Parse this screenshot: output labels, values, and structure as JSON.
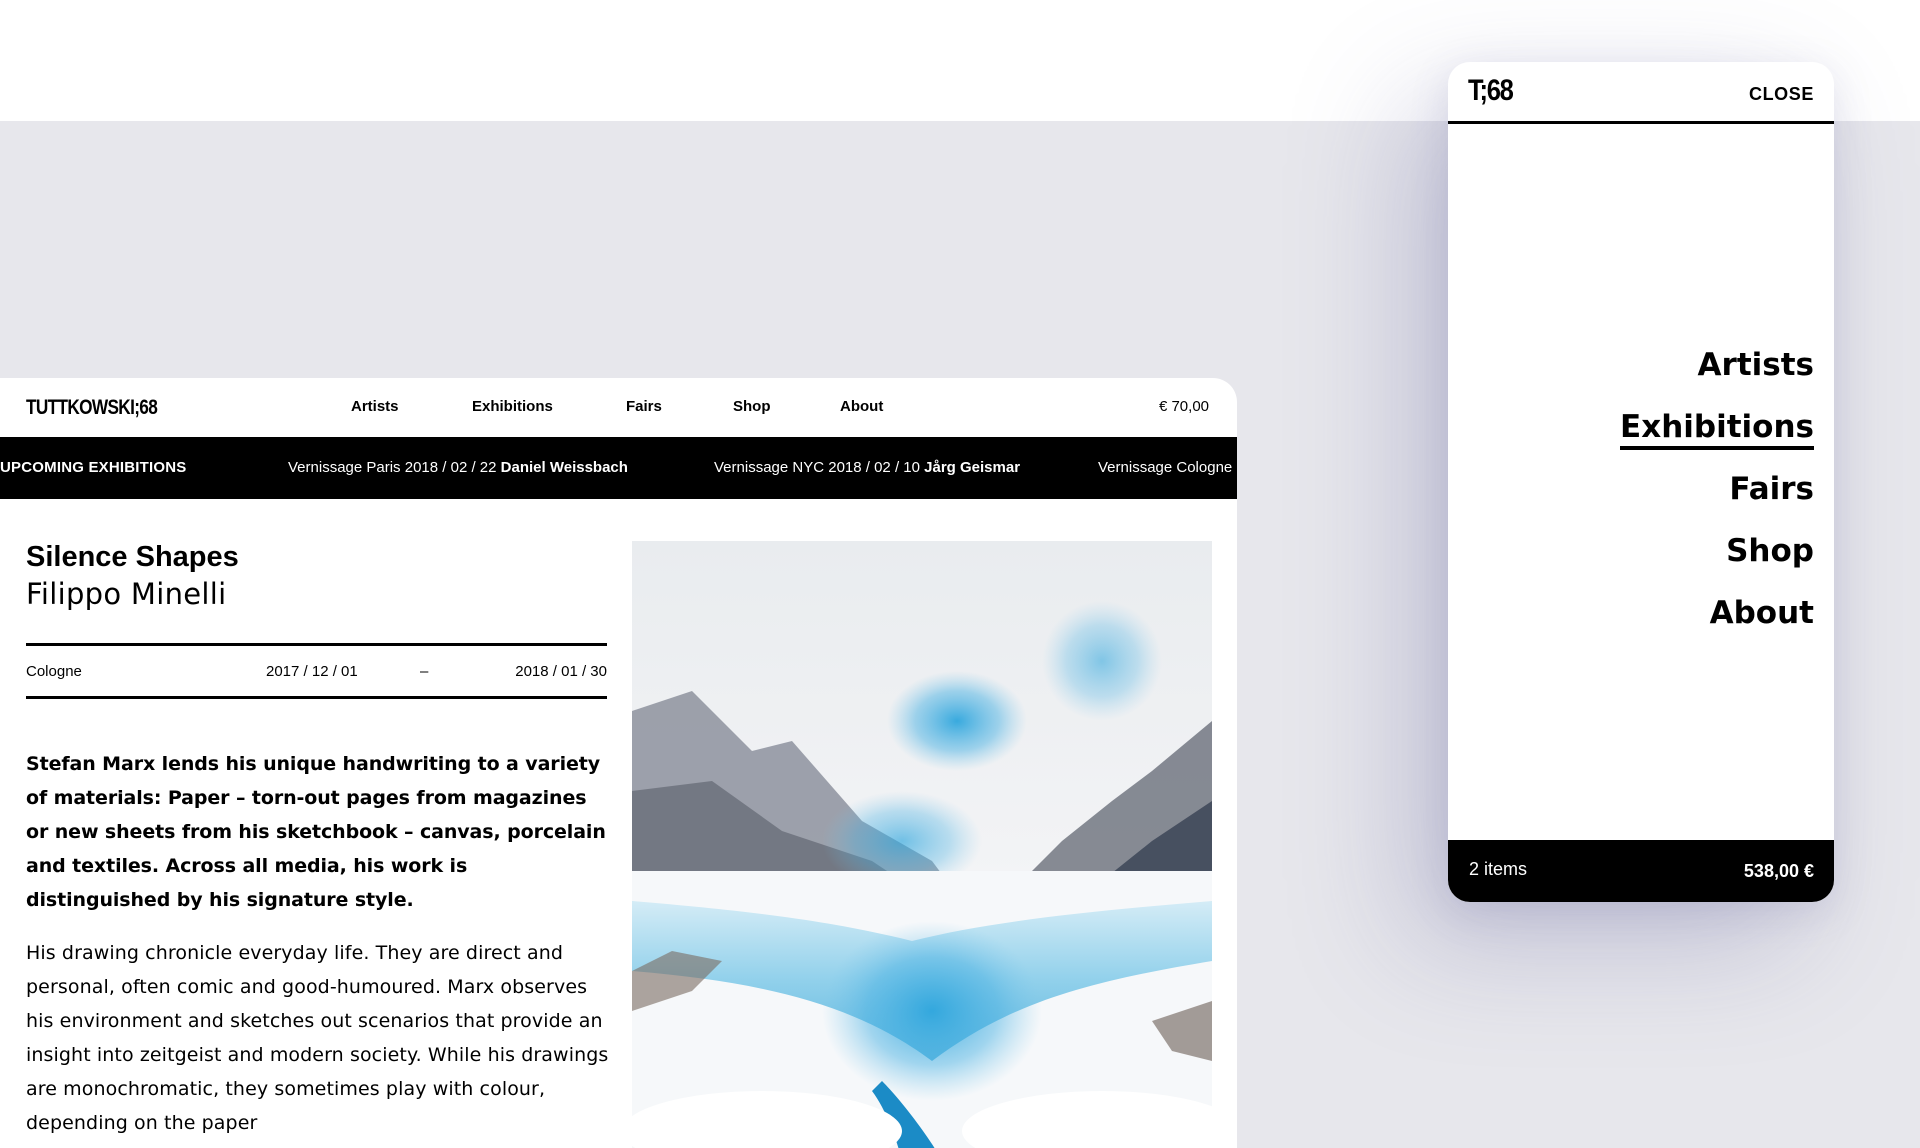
{
  "desktop": {
    "logo": "TUTTKOWSKI;68",
    "nav": [
      "Artists",
      "Exhibitions",
      "Fairs",
      "Shop",
      "About"
    ],
    "cart_total": "€ 70,00",
    "ticker": {
      "label": "UPCOMING EXHIBITIONS",
      "items": [
        {
          "prefix": "Vernissage Paris 2018 / 02 / 22",
          "artist": "Daniel Weissbach"
        },
        {
          "prefix": "Vernissage NYC 2018 / 02 / 10",
          "artist": "Jårg Geismar"
        },
        {
          "prefix": "Vernissage Cologne",
          "artist": ""
        }
      ]
    },
    "exhibition": {
      "title": "Silence Shapes",
      "artist": "Filippo Minelli",
      "location": "Cologne",
      "start_date": "2017 / 12 / 01",
      "separator": "–",
      "end_date": "2018 / 01 / 30",
      "lead": "Stefan Marx lends his unique handwriting to a variety of materials: Paper – torn-out pages from magazines or new sheets from his sketchbook – canvas, porcelain and textiles. Across all media, his work is distinguished by his signature style.",
      "body": "His drawing chronicle everyday life. They are direct and personal, often comic and good-humoured. Marx observes his environment and sketches out scenarios that provide an insight into zeitgeist and modern society. While his drawings are monochromatic, they sometimes play with colour, depending on the paper"
    }
  },
  "mobile": {
    "logo": "T;68",
    "close": "CLOSE",
    "menu": [
      "Artists",
      "Exhibitions",
      "Fairs",
      "Shop",
      "About"
    ],
    "active_item": "Exhibitions",
    "cart_items": "2 items",
    "cart_total": "538,00 €"
  }
}
